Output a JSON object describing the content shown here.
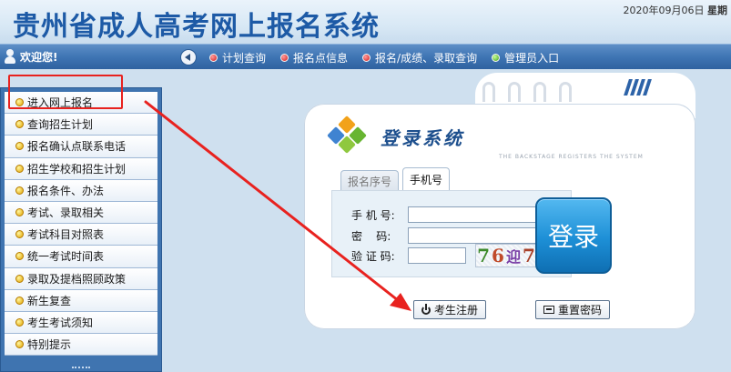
{
  "header": {
    "site_title": "贵州省成人高考网上报名系统",
    "date": "2020年09月06日",
    "weekday_fragment": "星期"
  },
  "navbar": {
    "welcome": "欢迎您!",
    "links": [
      {
        "label": "计划查询",
        "icon": "red-dot-icon"
      },
      {
        "label": "报名点信息",
        "icon": "red-dot-icon"
      },
      {
        "label": "报名/成绩、录取查询",
        "icon": "red-dot-icon"
      },
      {
        "label": "管理员入口",
        "icon": "green-dot-icon"
      }
    ]
  },
  "sidebar": {
    "items": [
      {
        "label": "进入网上报名"
      },
      {
        "label": "查询招生计划"
      },
      {
        "label": "报名确认点联系电话"
      },
      {
        "label": "招生学校和招生计划"
      },
      {
        "label": "报名条件、办法"
      },
      {
        "label": "考试、录取相关"
      },
      {
        "label": "考试科目对照表"
      },
      {
        "label": "统一考试时间表"
      },
      {
        "label": "录取及提档照顾政策"
      },
      {
        "label": "新生复查"
      },
      {
        "label": "考生考试须知"
      },
      {
        "label": "特别提示"
      }
    ]
  },
  "login": {
    "title": "登录系统",
    "subtitle": "THE BACKSTAGE REGISTERS THE SYSTEM",
    "tabs": [
      {
        "label": "报名序号",
        "active": false
      },
      {
        "label": "手机号",
        "active": true
      }
    ],
    "fields": {
      "phone_label": "手 机 号:",
      "phone_value": "",
      "password_label": "密    码:",
      "password_value": "",
      "captcha_label": "验 证 码:",
      "captcha_value": ""
    },
    "captcha_chars": [
      "7",
      "6",
      "迎",
      "7"
    ],
    "login_button": "登录",
    "register_button": "考生注册",
    "reset_button": "重置密码"
  },
  "colors": {
    "accent": "#1d5aa6",
    "nav_bg": "#3f75b4",
    "highlight": "#e8221f",
    "login_button": "#1d8fd6"
  }
}
